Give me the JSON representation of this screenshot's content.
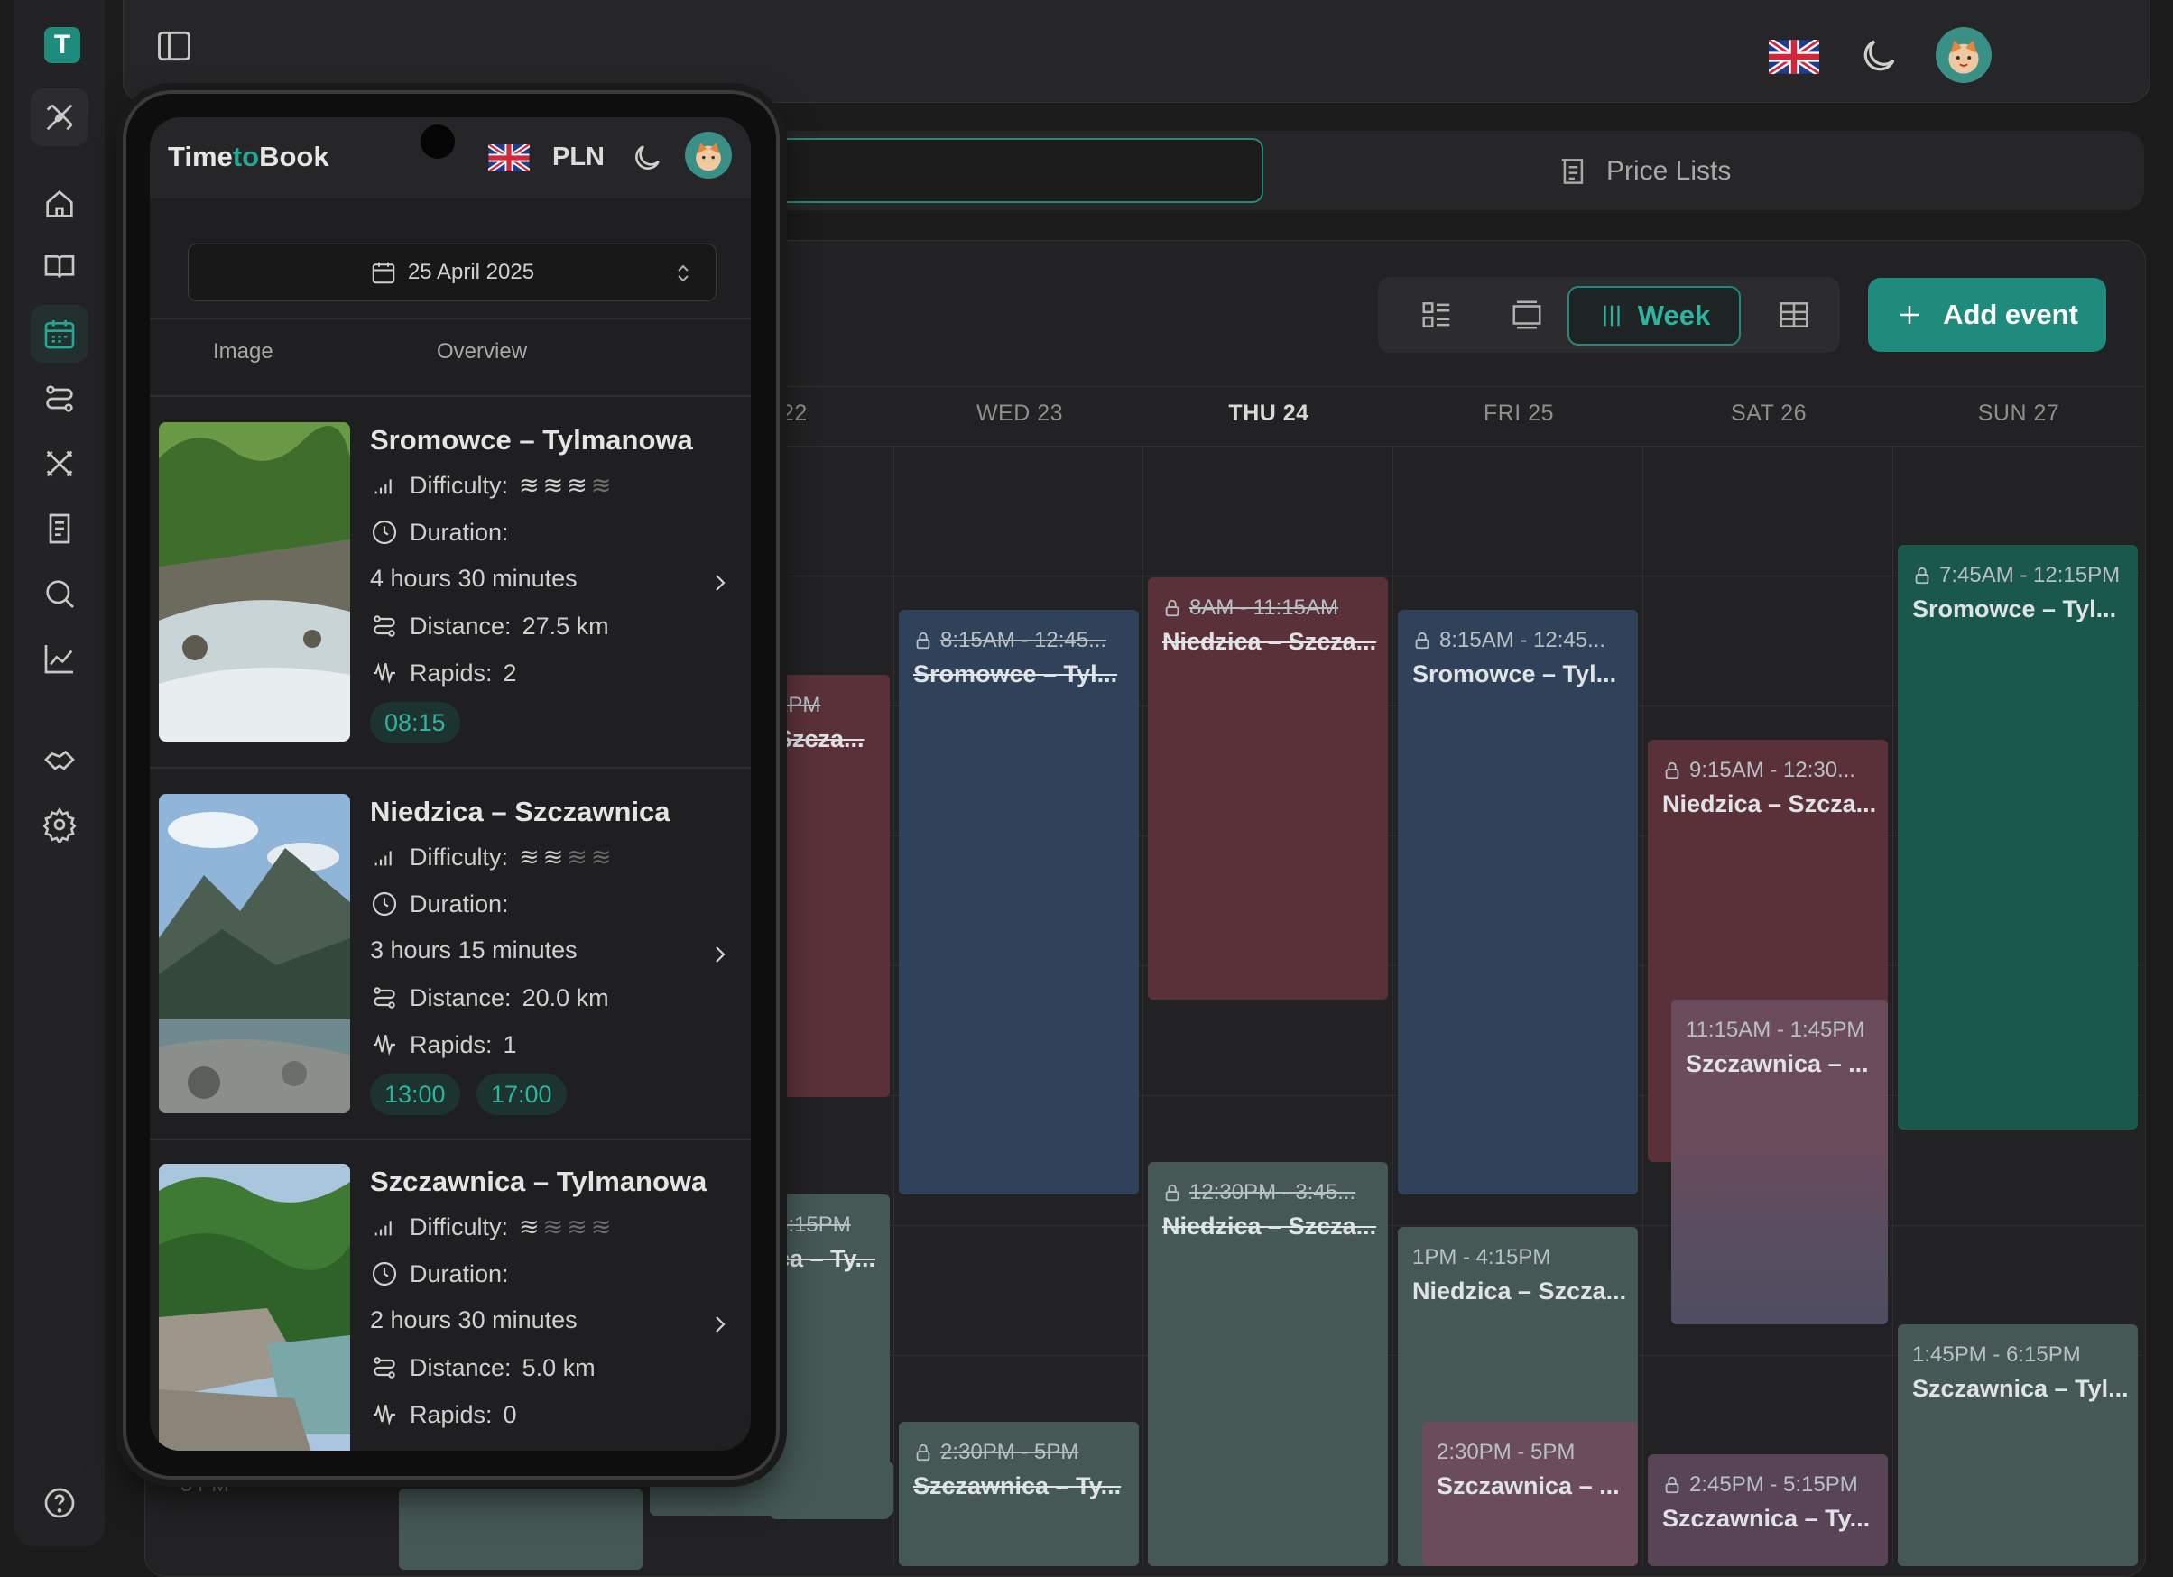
{
  "app": {
    "brand_prefix": "Time",
    "brand_mid": "to",
    "brand_suffix": "Book",
    "logo_letter": "T"
  },
  "topbar": {
    "language": "English",
    "theme": "dark"
  },
  "tabs": {
    "price_lists": "Price Lists"
  },
  "calendar": {
    "view_label": "Week",
    "add_event_label": "Add event",
    "days": [
      "22",
      "WED 23",
      "THU 24",
      "FRI 25",
      "SAT 26",
      "SUN 27"
    ],
    "today": "THU 24",
    "hour_label": "3 PM",
    "events": [
      {
        "time": "2PM",
        "name": "Szcza...",
        "strike": true
      },
      {
        "time": "3:15PM",
        "name": "ca – Ty...",
        "strike": true
      },
      {
        "time": "8:15AM - 12:45...",
        "name": "Sromowce – Tyl...",
        "strike": true
      },
      {
        "time": "2:30PM - 5PM",
        "name": "Szczawnica – Ty...",
        "strike": true
      },
      {
        "time": "8AM - 11:15AM",
        "name": "Niedzica – Szcza...",
        "strike": true
      },
      {
        "time": "12:30PM - 3:45...",
        "name": "Niedzica – Szcza...",
        "strike": true
      },
      {
        "time": "8:15AM - 12:45...",
        "name": "Sromowce – Tyl...",
        "strike": false
      },
      {
        "time": "1PM - 4:15PM",
        "name": "Niedzica – Szcza...",
        "strike": false
      },
      {
        "time": "2:30PM - 5PM",
        "name": "Szczawnica – ...",
        "strike": false
      },
      {
        "time": "9:15AM - 12:30...",
        "name": "Niedzica – Szcza...",
        "strike": false
      },
      {
        "time": "11:15AM - 1:45PM",
        "name": "Szczawnica – ...",
        "strike": false
      },
      {
        "time": "2:45PM - 5:15PM",
        "name": "Szczawnica – Ty...",
        "strike": false
      },
      {
        "time": "7:45AM - 12:15PM",
        "name": "Sromowce – Tyl...",
        "strike": false
      },
      {
        "time": "1:45PM - 6:15PM",
        "name": "Szczawnica – Tyl...",
        "strike": false
      }
    ]
  },
  "phone": {
    "brand_prefix": "Time",
    "brand_mid": "to",
    "brand_suffix": "Book",
    "currency": "PLN",
    "date": "25 April 2025",
    "columns": [
      "Image",
      "Overview"
    ],
    "labels": {
      "difficulty": "Difficulty:",
      "duration": "Duration:",
      "distance": "Distance:",
      "rapids": "Rapids:"
    },
    "tours": [
      {
        "title": "Sromowce – Tylmanowa",
        "difficulty": 3,
        "duration": "4 hours 30 minutes",
        "distance": "27.5 km",
        "rapids": "2",
        "times": [
          "08:15"
        ]
      },
      {
        "title": "Niedzica – Szczawnica",
        "difficulty": 2,
        "duration": "3 hours 15 minutes",
        "distance": "20.0 km",
        "rapids": "1",
        "times": [
          "13:00",
          "17:00"
        ]
      },
      {
        "title": "Szczawnica – Tylmanowa",
        "difficulty": 1,
        "duration": "2 hours 30 minutes",
        "distance": "5.0 km",
        "rapids": "0",
        "times": []
      }
    ]
  }
}
